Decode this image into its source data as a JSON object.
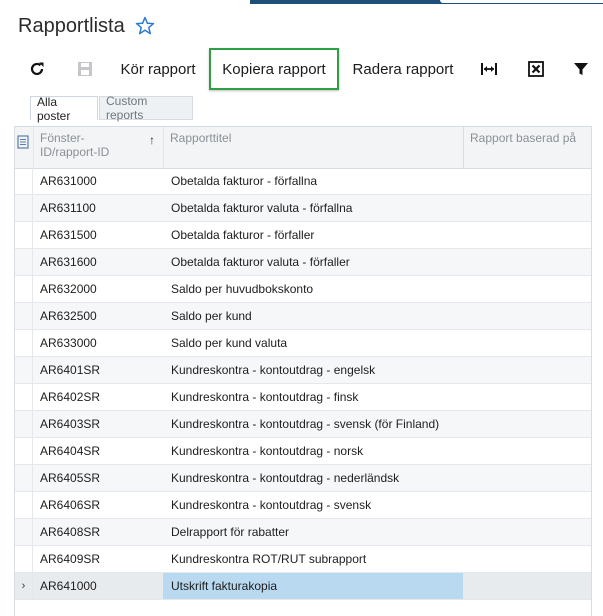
{
  "header": {
    "title": "Rapportlista"
  },
  "toolbar": {
    "refresh_icon": "refresh-icon",
    "save_icon": "save-icon",
    "run_label": "Kör rapport",
    "copy_label": "Kopiera rapport",
    "delete_label": "Radera rapport",
    "fit_icon": "fit-columns-icon",
    "export_icon": "export-excel-icon",
    "filter_icon": "filter-icon",
    "highlight_color": "#2ea043"
  },
  "tabs": [
    {
      "label": "Alla poster",
      "active": true
    },
    {
      "label": "Custom reports",
      "active": false
    }
  ],
  "grid": {
    "columns": {
      "id": "Fönster-ID/rapport-ID",
      "title": "Rapporttitel",
      "base": "Rapport baserad på"
    },
    "rows": [
      {
        "id": "AR631000",
        "title": "Obetalda fakturor - förfallna"
      },
      {
        "id": "AR631100",
        "title": "Obetalda fakturor valuta - förfallna"
      },
      {
        "id": "AR631500",
        "title": "Obetalda fakturor - förfaller"
      },
      {
        "id": "AR631600",
        "title": "Obetalda fakturor valuta - förfaller"
      },
      {
        "id": "AR632000",
        "title": "Saldo per huvudbokskonto"
      },
      {
        "id": "AR632500",
        "title": "Saldo per kund"
      },
      {
        "id": "AR633000",
        "title": "Saldo per kund valuta"
      },
      {
        "id": "AR6401SR",
        "title": "Kundreskontra - kontoutdrag - engelsk"
      },
      {
        "id": "AR6402SR",
        "title": "Kundreskontra - kontoutdrag - finsk"
      },
      {
        "id": "AR6403SR",
        "title": "Kundreskontra - kontoutdrag - svensk (för Finland)"
      },
      {
        "id": "AR6404SR",
        "title": "Kundreskontra - kontoutdrag - norsk"
      },
      {
        "id": "AR6405SR",
        "title": "Kundreskontra - kontoutdrag - nederländsk"
      },
      {
        "id": "AR6406SR",
        "title": "Kundreskontra - kontoutdrag - svensk"
      },
      {
        "id": "AR6408SR",
        "title": "Delrapport för rabatter"
      },
      {
        "id": "AR6409SR",
        "title": "Kundreskontra ROT/RUT subrapport"
      },
      {
        "id": "AR641000",
        "title": "Utskrift fakturakopia",
        "current": true
      }
    ]
  }
}
